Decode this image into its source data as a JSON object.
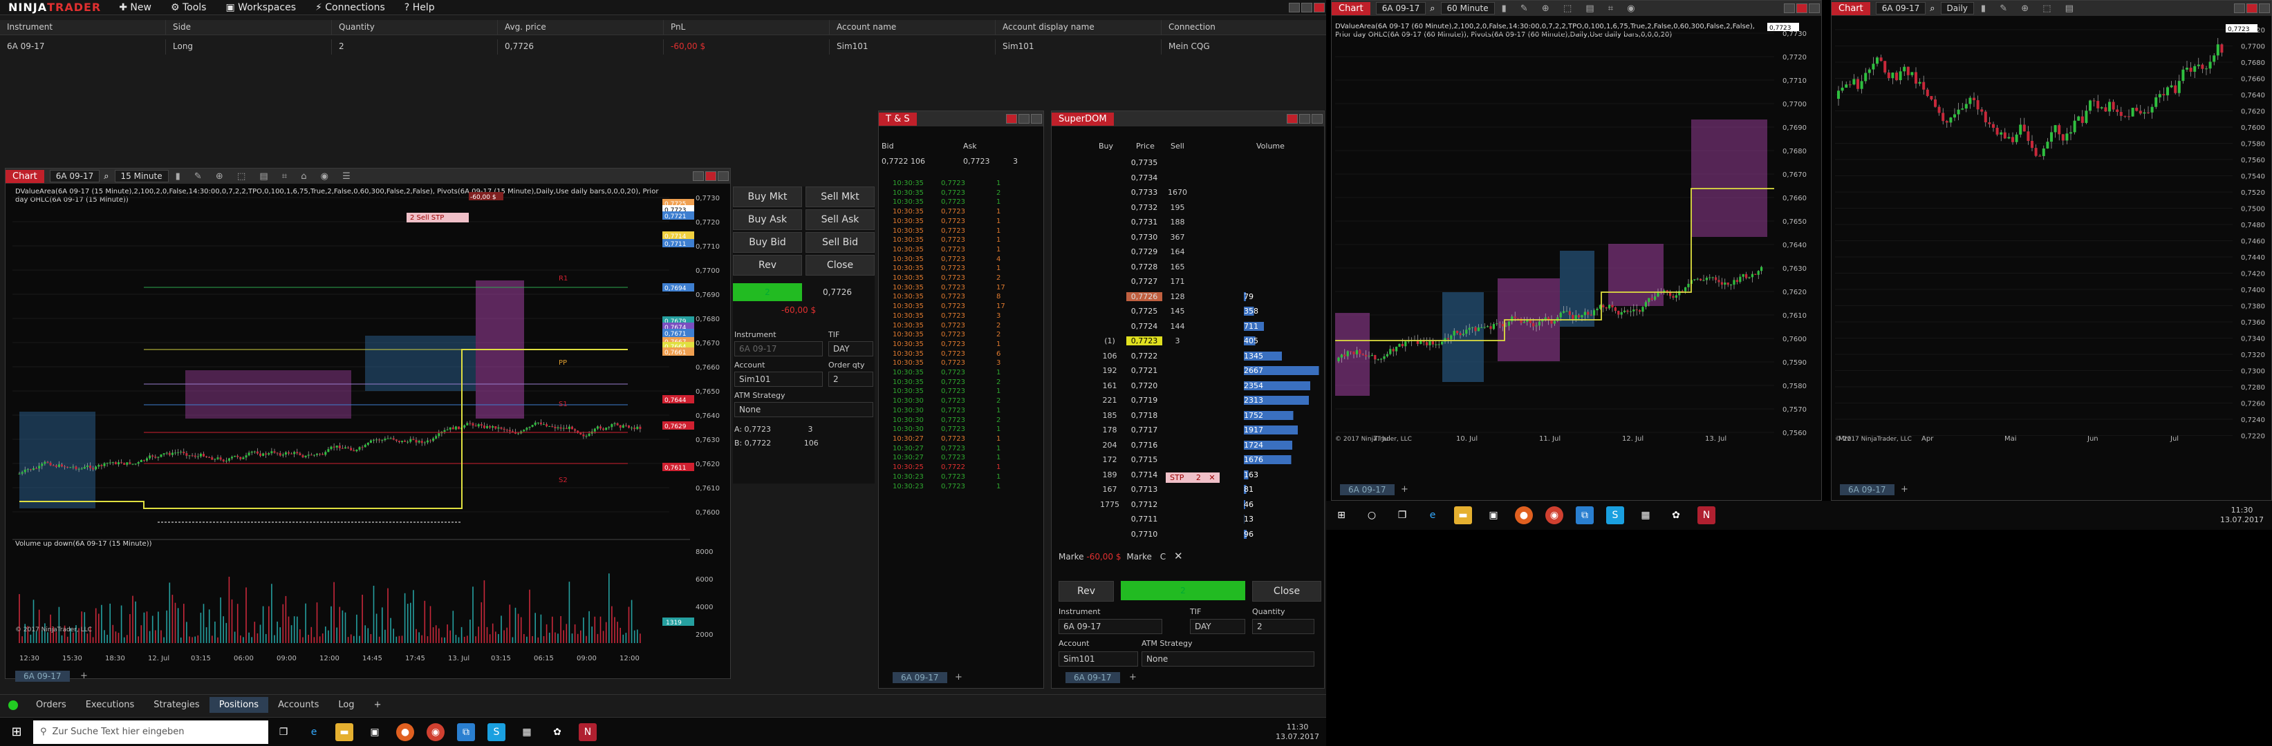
{
  "app": {
    "logo_prefix": "NINJA",
    "logo_suffix": "TRADER"
  },
  "menu": [
    "New",
    "Tools",
    "Workspaces",
    "Connections",
    "Help"
  ],
  "positions": {
    "columns": [
      "Instrument",
      "Side",
      "Quantity",
      "Avg. price",
      "PnL",
      "Account name",
      "Account display name",
      "Connection"
    ],
    "row": [
      "6A 09-17",
      "Long",
      "2",
      "0,7726",
      "-60,00 $",
      "Sim101",
      "Sim101",
      "Mein CQG"
    ]
  },
  "chart1": {
    "title": "Chart",
    "instrument": "6A 09-17",
    "interval": "15 Minute",
    "indicators": "DValueArea(6A 09-17 (15 Minute),2,100,2,0,False,14:30:00,0,7,2,2,TPO,0,100,1,6,75,True,2,False,0,60,300,False,2,False), Pivots(6A 09-17 (15 Minute),Daily,Use daily bars,0,0,0,20), Prior day OHLC(6A 09-17 (15 Minute))",
    "volume_label": "Volume up down(6A 09-17 (15 Minute))",
    "copyright": "© 2017 NinjaTrader, LLC",
    "stop_label": "2  Sell STP",
    "pnl_label": "-60,00 $",
    "price_ticks": [
      "0,7730",
      "0,7720",
      "0,7710",
      "0,7700",
      "0,7690",
      "0,7680",
      "0,7670",
      "0,7660",
      "0,7650",
      "0,7640",
      "0,7630",
      "0,7620",
      "0,7610",
      "0,7600"
    ],
    "tags": [
      {
        "t": "0,7725",
        "c": "#f0a050"
      },
      {
        "t": "0,7723",
        "c": "#ffffff"
      },
      {
        "t": "0,7721",
        "c": "#3e7fd0"
      },
      {
        "t": "0,7714",
        "c": "#f0d040"
      },
      {
        "t": "0,7711",
        "c": "#3e7fd0"
      },
      {
        "t": "0,7694",
        "c": "#3e7fd0"
      },
      {
        "t": "0,7679",
        "c": "#25a0a0"
      },
      {
        "t": "0,7674",
        "c": "#7a4fc0"
      },
      {
        "t": "0,7671",
        "c": "#3e7fd0"
      },
      {
        "t": "0,7667",
        "c": "#f0a050"
      },
      {
        "t": "0,7664",
        "c": "#e0e040"
      },
      {
        "t": "0,7661",
        "c": "#f0a050"
      },
      {
        "t": "0,7644",
        "c": "#d02030"
      },
      {
        "t": "0,7629",
        "c": "#d02030"
      },
      {
        "t": "0,7611",
        "c": "#d02030"
      }
    ],
    "vol_ticks": [
      "8000",
      "6000",
      "4000",
      "2000"
    ],
    "vol_tag": "1319",
    "time_ticks": [
      "12:30",
      "15:30",
      "18:30",
      "12. Jul",
      "03:15",
      "06:00",
      "09:00",
      "12:00",
      "14:45",
      "17:45",
      "13. Jul",
      "03:15",
      "06:15",
      "09:00",
      "12:00"
    ],
    "pivot_labels": [
      "R1",
      "PP",
      "S1",
      "S2"
    ],
    "tab": "6A 09-17"
  },
  "order_panel": {
    "buy_mkt": "Buy Mkt",
    "sell_mkt": "Sell Mkt",
    "buy_ask": "Buy Ask",
    "sell_ask": "Sell Ask",
    "buy_bid": "Buy Bid",
    "sell_bid": "Sell Bid",
    "rev": "Rev",
    "close": "Close",
    "qty": "2",
    "avg": "0,7726",
    "pnl": "-60,00 $",
    "instrument_label": "Instrument",
    "instrument": "6A 09-17",
    "tif_label": "TIF",
    "tif": "DAY",
    "account_label": "Account",
    "account": "Sim101",
    "qty_label": "Order qty",
    "order_qty": "2",
    "atm_label": "ATM Strategy",
    "atm": "None",
    "a_label": "A:",
    "a_price": "0,7723",
    "a_qty": "3",
    "b_label": "B:",
    "b_price": "0,7722",
    "b_qty": "106"
  },
  "tas": {
    "title": "T & S",
    "bid_label": "Bid",
    "ask_label": "Ask",
    "bid": "0,7722",
    "bid_qty": "106",
    "ask": "0,7723",
    "ask_qty": "3",
    "rows": [
      [
        "10:30:35",
        "0,7723",
        "1",
        "g"
      ],
      [
        "10:30:35",
        "0,7723",
        "2",
        "g"
      ],
      [
        "10:30:35",
        "0,7723",
        "1",
        "g"
      ],
      [
        "10:30:35",
        "0,7723",
        "1",
        "o"
      ],
      [
        "10:30:35",
        "0,7723",
        "1",
        "o"
      ],
      [
        "10:30:35",
        "0,7723",
        "1",
        "o"
      ],
      [
        "10:30:35",
        "0,7723",
        "1",
        "o"
      ],
      [
        "10:30:35",
        "0,7723",
        "1",
        "o"
      ],
      [
        "10:30:35",
        "0,7723",
        "4",
        "o"
      ],
      [
        "10:30:35",
        "0,7723",
        "1",
        "o"
      ],
      [
        "10:30:35",
        "0,7723",
        "2",
        "o"
      ],
      [
        "10:30:35",
        "0,7723",
        "17",
        "o"
      ],
      [
        "10:30:35",
        "0,7723",
        "8",
        "o"
      ],
      [
        "10:30:35",
        "0,7723",
        "17",
        "o"
      ],
      [
        "10:30:35",
        "0,7723",
        "3",
        "o"
      ],
      [
        "10:30:35",
        "0,7723",
        "2",
        "o"
      ],
      [
        "10:30:35",
        "0,7723",
        "2",
        "o"
      ],
      [
        "10:30:35",
        "0,7723",
        "1",
        "o"
      ],
      [
        "10:30:35",
        "0,7723",
        "6",
        "o"
      ],
      [
        "10:30:35",
        "0,7723",
        "3",
        "o"
      ],
      [
        "10:30:35",
        "0,7723",
        "1",
        "g"
      ],
      [
        "10:30:35",
        "0,7723",
        "2",
        "g"
      ],
      [
        "10:30:35",
        "0,7723",
        "1",
        "g"
      ],
      [
        "10:30:30",
        "0,7723",
        "2",
        "g"
      ],
      [
        "10:30:30",
        "0,7723",
        "1",
        "g"
      ],
      [
        "10:30:30",
        "0,7723",
        "2",
        "g"
      ],
      [
        "10:30:30",
        "0,7723",
        "1",
        "g"
      ],
      [
        "10:30:27",
        "0,7723",
        "1",
        "o"
      ],
      [
        "10:30:27",
        "0,7723",
        "1",
        "g"
      ],
      [
        "10:30:27",
        "0,7723",
        "1",
        "g"
      ],
      [
        "10:30:25",
        "0,7722",
        "1",
        "r"
      ],
      [
        "10:30:23",
        "0,7723",
        "1",
        "g"
      ],
      [
        "10:30:23",
        "0,7723",
        "1",
        "g"
      ]
    ],
    "tab": "6A 09-17"
  },
  "dom": {
    "title": "SuperDOM",
    "buy_label": "Buy",
    "price_label": "Price",
    "sell_label": "Sell",
    "volume_label": "Volume",
    "rows": [
      {
        "buy": "",
        "price": "0,7735",
        "sell": "",
        "vol": ""
      },
      {
        "buy": "",
        "price": "0,7734",
        "sell": "",
        "vol": ""
      },
      {
        "buy": "",
        "price": "0,7733",
        "sell": "1670",
        "vol": ""
      },
      {
        "buy": "",
        "price": "0,7732",
        "sell": "195",
        "vol": ""
      },
      {
        "buy": "",
        "price": "0,7731",
        "sell": "188",
        "vol": ""
      },
      {
        "buy": "",
        "price": "0,7730",
        "sell": "367",
        "vol": ""
      },
      {
        "buy": "",
        "price": "0,7729",
        "sell": "164",
        "vol": ""
      },
      {
        "buy": "",
        "price": "0,7728",
        "sell": "165",
        "vol": ""
      },
      {
        "buy": "",
        "price": "0,7727",
        "sell": "171",
        "vol": ""
      },
      {
        "buy": "",
        "price": "0,7726",
        "sell": "128",
        "vol": "79"
      },
      {
        "buy": "",
        "price": "0,7725",
        "sell": "145",
        "vol": "358"
      },
      {
        "buy": "",
        "price": "0,7724",
        "sell": "144",
        "vol": "711"
      },
      {
        "buy": "(1)",
        "price": "0,7723",
        "sell": "3",
        "vol": "405"
      },
      {
        "buy": "106",
        "price": "0,7722",
        "sell": "",
        "vol": "1345"
      },
      {
        "buy": "192",
        "price": "0,7721",
        "sell": "",
        "vol": "2667"
      },
      {
        "buy": "161",
        "price": "0,7720",
        "sell": "",
        "vol": "2354"
      },
      {
        "buy": "221",
        "price": "0,7719",
        "sell": "",
        "vol": "2313"
      },
      {
        "buy": "185",
        "price": "0,7718",
        "sell": "",
        "vol": "1752"
      },
      {
        "buy": "178",
        "price": "0,7717",
        "sell": "",
        "vol": "1917"
      },
      {
        "buy": "204",
        "price": "0,7716",
        "sell": "",
        "vol": "1724"
      },
      {
        "buy": "172",
        "price": "0,7715",
        "sell": "",
        "vol": "1676"
      },
      {
        "buy": "189",
        "price": "0,7714",
        "sell": "",
        "vol": "163"
      },
      {
        "buy": "167",
        "price": "0,7713",
        "sell": "",
        "vol": "81"
      },
      {
        "buy": "1775",
        "price": "0,7712",
        "sell": "",
        "vol": "46"
      },
      {
        "buy": "",
        "price": "0,7711",
        "sell": "",
        "vol": "13"
      },
      {
        "buy": "",
        "price": "0,7710",
        "sell": "",
        "vol": "96"
      }
    ],
    "stp_label": "STP",
    "stp_qty": "2",
    "market_label": "Marke",
    "market_pnl": "-60,00 $",
    "c_label": "C",
    "rev": "Rev",
    "qty": "2",
    "close": "Close",
    "instrument_label": "Instrument",
    "instrument": "6A 09-17",
    "tif_label": "TIF",
    "tif": "DAY",
    "qty_label": "Quantity",
    "quantity": "2",
    "account_label": "Account",
    "account": "Sim101",
    "atm_label": "ATM Strategy",
    "atm": "None",
    "tab": "6A 09-17"
  },
  "bottom_tabs": [
    "Orders",
    "Executions",
    "Strategies",
    "Positions",
    "Accounts",
    "Log"
  ],
  "taskbar": {
    "search_placeholder": "Zur Suche Text hier eingeben",
    "time": "11:30",
    "date": "13.07.2017"
  },
  "chart2": {
    "title": "Chart",
    "instrument": "6A 09-17",
    "interval": "60 Minute",
    "indicators": "DValueArea(6A 09-17 (60 Minute),2,100,2,0,False,14:30:00,0,7,2,2,TPO,0,100,1,6,75,True,2,False,0,60,300,False,2,False), Prior day OHLC(6A 09-17 (60 Minute)), Pivots(6A 09-17 (60 Minute),Daily,Use daily bars,0,0,0,20)",
    "copyright": "© 2017 NinjaTrader, LLC",
    "price_ticks": [
      "0,7730",
      "0,7720",
      "0,7710",
      "0,7700",
      "0,7690",
      "0,7680",
      "0,7670",
      "0,7660",
      "0,7650",
      "0,7640",
      "0,7630",
      "0,7620",
      "0,7610",
      "0,7600",
      "0,7590",
      "0,7580",
      "0,7570",
      "0,7560"
    ],
    "top_tag": "0,7723",
    "time_ticks": [
      "7. Jul",
      "10. Jul",
      "11. Jul",
      "12. Jul",
      "13. Jul"
    ],
    "tab": "6A 09-17"
  },
  "chart3": {
    "title": "Chart",
    "instrument": "6A 09-17",
    "interval": "Daily",
    "copyright": "© 2017 NinjaTrader, LLC",
    "price_ticks": [
      "0,7720",
      "0,7700",
      "0,7680",
      "0,7660",
      "0,7640",
      "0,7620",
      "0,7600",
      "0,7580",
      "0,7560",
      "0,7540",
      "0,7520",
      "0,7500",
      "0,7480",
      "0,7460",
      "0,7440",
      "0,7420",
      "0,7400",
      "0,7380",
      "0,7360",
      "0,7340",
      "0,7320",
      "0,7300",
      "0,7280",
      "0,7260",
      "0,7240",
      "0,7220"
    ],
    "top_tag": "0,7723",
    "time_ticks": [
      "Mrz",
      "Apr",
      "Mai",
      "Jun",
      "Jul"
    ],
    "tab": "6A 09-17"
  },
  "sec_taskbar": {
    "time": "11:30",
    "date": "13.07.2017"
  }
}
